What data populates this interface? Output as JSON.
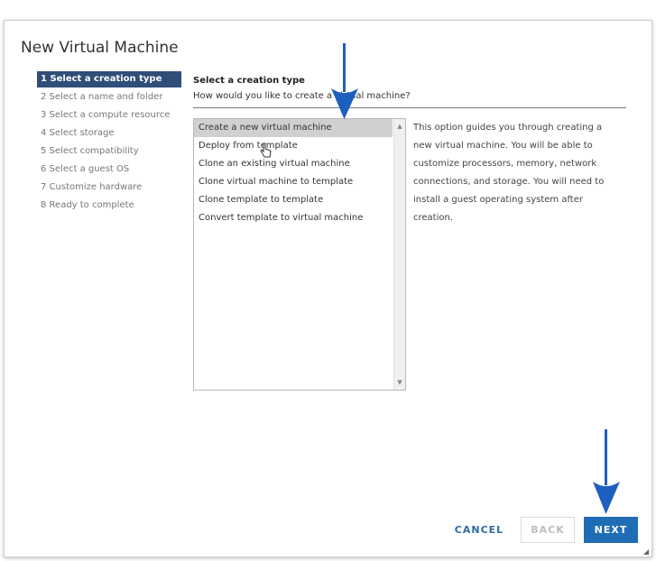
{
  "dialog": {
    "title": "New Virtual Machine"
  },
  "steps": [
    {
      "label": "1 Select a creation type",
      "active": true
    },
    {
      "label": "2 Select a name and folder",
      "active": false
    },
    {
      "label": "3 Select a compute resource",
      "active": false
    },
    {
      "label": "4 Select storage",
      "active": false
    },
    {
      "label": "5 Select compatibility",
      "active": false
    },
    {
      "label": "6 Select a guest OS",
      "active": false
    },
    {
      "label": "7 Customize hardware",
      "active": false
    },
    {
      "label": "8 Ready to complete",
      "active": false
    }
  ],
  "section": {
    "title": "Select a creation type",
    "question": "How would you like to create a virtual machine?"
  },
  "creation_types": [
    {
      "label": "Create a new virtual machine",
      "selected": true
    },
    {
      "label": "Deploy from template",
      "selected": false
    },
    {
      "label": "Clone an existing virtual machine",
      "selected": false
    },
    {
      "label": "Clone virtual machine to template",
      "selected": false
    },
    {
      "label": "Clone template to template",
      "selected": false
    },
    {
      "label": "Convert template to virtual machine",
      "selected": false
    }
  ],
  "description": "This option guides you through creating a new virtual machine. You will be able to customize processors, memory, network connections, and storage. You will need to install a guest operating system after creation.",
  "footer": {
    "cancel_label": "CANCEL",
    "back_label": "BACK",
    "next_label": "NEXT"
  },
  "colors": {
    "active_step_bg": "#2f4e78",
    "primary_button": "#1f6db5",
    "annotation_arrow": "#1d5fbf"
  },
  "icons": {
    "scroll_up": "triangle-up-icon",
    "scroll_down": "triangle-down-icon",
    "annotation": "down-arrow-annotation-icon",
    "cursor": "hand-pointer-icon"
  }
}
